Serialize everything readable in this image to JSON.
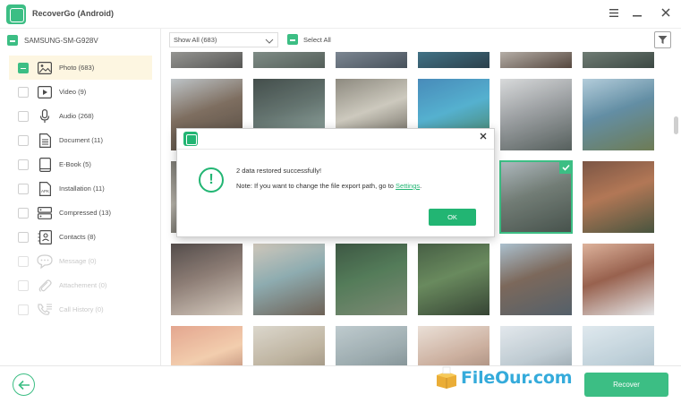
{
  "app": {
    "title": "RecoverGo (Android)",
    "logo_letter": "R",
    "menu_icon": "hamburger-icon",
    "minimize_icon": "minimize-icon",
    "close_icon": "close-icon"
  },
  "sidebar": {
    "device": "SAMSUNG-SM-G928V",
    "items": [
      {
        "label": "Photo (683)",
        "icon": "photo-icon",
        "selected": true,
        "state": "partial",
        "enabled": true
      },
      {
        "label": "Video (9)",
        "icon": "video-icon",
        "selected": false,
        "state": "unchecked",
        "enabled": true
      },
      {
        "label": "Audio (268)",
        "icon": "microphone-icon",
        "selected": false,
        "state": "unchecked",
        "enabled": true
      },
      {
        "label": "Document (11)",
        "icon": "document-icon",
        "selected": false,
        "state": "unchecked",
        "enabled": true
      },
      {
        "label": "E-Book (5)",
        "icon": "ebook-icon",
        "selected": false,
        "state": "unchecked",
        "enabled": true
      },
      {
        "label": "Installation (11)",
        "icon": "apk-icon",
        "selected": false,
        "state": "unchecked",
        "enabled": true
      },
      {
        "label": "Compressed (13)",
        "icon": "archive-icon",
        "selected": false,
        "state": "unchecked",
        "enabled": true
      },
      {
        "label": "Contacts (8)",
        "icon": "contacts-icon",
        "selected": false,
        "state": "unchecked",
        "enabled": true
      },
      {
        "label": "Message (0)",
        "icon": "message-icon",
        "selected": false,
        "state": "unchecked",
        "enabled": false
      },
      {
        "label": "Attachement (0)",
        "icon": "paperclip-icon",
        "selected": false,
        "state": "unchecked",
        "enabled": false
      },
      {
        "label": "Call History (0)",
        "icon": "call-history-icon",
        "selected": false,
        "state": "unchecked",
        "enabled": false
      }
    ]
  },
  "toolbar": {
    "filter_value": "Show All (683)",
    "select_all_label": "Select All",
    "filter_icon": "funnel-icon"
  },
  "grid": {
    "thumbnails": [
      {
        "name": "photo-thumb-r1c1",
        "colors": [
          "#6b6b69",
          "#9a9a96",
          "#3f3f3d"
        ],
        "selected": false
      },
      {
        "name": "photo-thumb-r1c2",
        "colors": [
          "#596559",
          "#7a8a83",
          "#3d4943"
        ],
        "selected": false
      },
      {
        "name": "photo-thumb-r1c3",
        "colors": [
          "#4d5866",
          "#7a8694",
          "#2f3a45"
        ],
        "selected": false
      },
      {
        "name": "photo-thumb-r1c4",
        "colors": [
          "#1d3b4c",
          "#2e6f88",
          "#0f2633"
        ],
        "selected": false
      },
      {
        "name": "photo-thumb-r1c5",
        "colors": [
          "#7b6e63",
          "#c9c3bb",
          "#3e2e24"
        ],
        "selected": false
      },
      {
        "name": "photo-thumb-r1c6",
        "colors": [
          "#3f4a44",
          "#6b7a70",
          "#22302a"
        ],
        "selected": false
      },
      {
        "name": "photo-thumb-r2c1",
        "colors": [
          "#b5bcc0",
          "#6c5a4a",
          "#3a3026"
        ],
        "selected": false
      },
      {
        "name": "photo-thumb-r2c2",
        "colors": [
          "#2a3633",
          "#50625d",
          "#8fa8a1"
        ],
        "selected": false
      },
      {
        "name": "photo-thumb-r2c3",
        "colors": [
          "#7e7a6e",
          "#c6c2b5",
          "#3f3a30"
        ],
        "selected": false
      },
      {
        "name": "photo-thumb-r2c4",
        "colors": [
          "#2f7bb0",
          "#3ea6c9",
          "#2d6b3c"
        ],
        "selected": false
      },
      {
        "name": "photo-thumb-r2c5",
        "colors": [
          "#d3d5d6",
          "#8f9396",
          "#3f4a47"
        ],
        "selected": false
      },
      {
        "name": "photo-thumb-r2c6",
        "colors": [
          "#a9c6d6",
          "#4e7f98",
          "#5a6a3d"
        ],
        "selected": false
      },
      {
        "name": "photo-thumb-r3c1",
        "colors": [
          "#6c6a62",
          "#a8a49a",
          "#3a3832"
        ],
        "selected": false
      },
      {
        "name": "photo-thumb-r3c2",
        "colors": [
          "#c7c9c4",
          "#8a9088",
          "#4b4f49"
        ],
        "selected": false
      },
      {
        "name": "photo-thumb-r3c3",
        "colors": [
          "#5b6a70",
          "#9aa7ac",
          "#303b40"
        ],
        "selected": false
      },
      {
        "name": "photo-thumb-r3c4",
        "colors": [
          "#3e5a3a",
          "#6f8d63",
          "#1f2f1d"
        ],
        "selected": false
      },
      {
        "name": "photo-thumb-r3c5",
        "colors": [
          "#a4b0b6",
          "#5f6b63",
          "#2d3a33"
        ],
        "selected": true
      },
      {
        "name": "photo-thumb-r3c6",
        "colors": [
          "#6a3f2c",
          "#a8653f",
          "#2f3d24"
        ],
        "selected": false
      },
      {
        "name": "photo-thumb-r4c1",
        "colors": [
          "#3c3432",
          "#7d6b62",
          "#d0c4b6"
        ],
        "selected": false
      },
      {
        "name": "photo-thumb-r4c2",
        "colors": [
          "#c9c0b2",
          "#7fa1a6",
          "#5a4c3f"
        ],
        "selected": false
      },
      {
        "name": "photo-thumb-r4c3",
        "colors": [
          "#23412a",
          "#3d6a43",
          "#6b7a62"
        ],
        "selected": false
      },
      {
        "name": "photo-thumb-r4c4",
        "colors": [
          "#2e4a2c",
          "#557a48",
          "#1b2b19"
        ],
        "selected": false
      },
      {
        "name": "photo-thumb-r4c5",
        "colors": [
          "#9fb7c7",
          "#6a5445",
          "#3d4b56"
        ],
        "selected": false
      },
      {
        "name": "photo-thumb-r4c6",
        "colors": [
          "#d9a88e",
          "#8a4c36",
          "#e2e4e6"
        ],
        "selected": false
      },
      {
        "name": "photo-thumb-r5c1",
        "colors": [
          "#e09a80",
          "#f1c7a3",
          "#8a4a3a"
        ],
        "selected": false
      },
      {
        "name": "photo-thumb-r5c2",
        "colors": [
          "#d7d2c6",
          "#b6aa94",
          "#726553"
        ],
        "selected": false
      },
      {
        "name": "photo-thumb-r5c3",
        "colors": [
          "#b6c4c8",
          "#8fa0a4",
          "#536468"
        ],
        "selected": false
      },
      {
        "name": "photo-thumb-r5c4",
        "colors": [
          "#e8dcd2",
          "#c5a592",
          "#7b5e4e"
        ],
        "selected": false
      },
      {
        "name": "photo-thumb-r5c5",
        "colors": [
          "#dfe5ea",
          "#b6c4cc",
          "#6a7a84"
        ],
        "selected": false
      },
      {
        "name": "photo-thumb-r5c6",
        "colors": [
          "#dbe6ec",
          "#b9ccd6",
          "#8ea6b3"
        ],
        "selected": false
      }
    ]
  },
  "dialog": {
    "line1": "2 data restored successfully!",
    "line2_prefix": "Note: If you want to change the file export path, go to ",
    "link": "Settings",
    "line2_suffix": ".",
    "ok_label": "OK",
    "status_icon": "exclamation-circle-icon",
    "close_icon": "close-icon"
  },
  "footer": {
    "back_icon": "arrow-left-circle-icon",
    "recover_label": "Recover"
  },
  "watermark": {
    "text": "FileOur.com"
  },
  "colors": {
    "accent": "#22b573",
    "selected_row": "#fdf5dd",
    "watermark": "#1aa0d6"
  }
}
